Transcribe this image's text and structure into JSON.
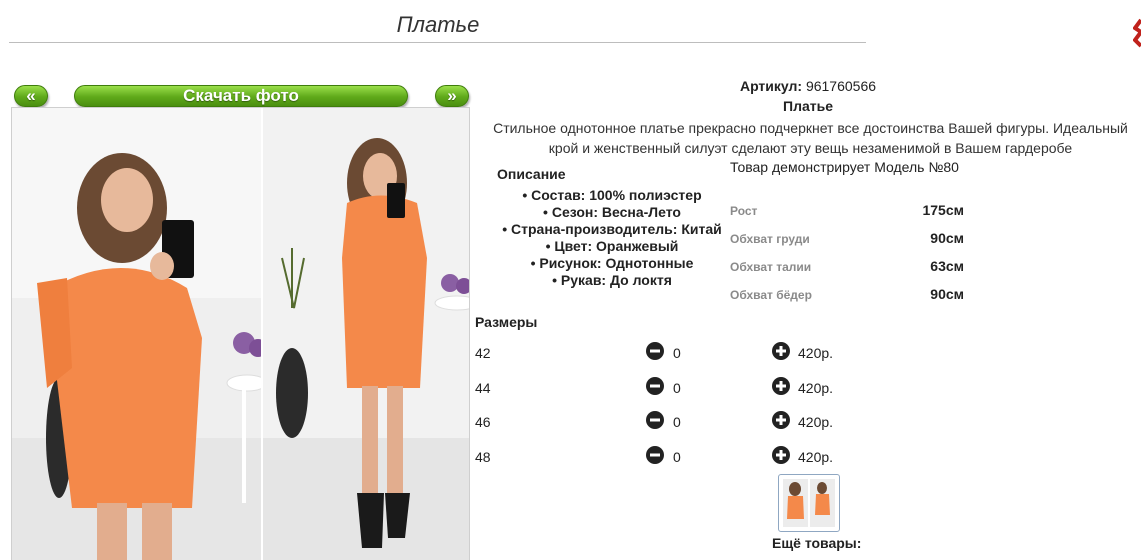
{
  "header": {
    "title": "Платье"
  },
  "nav": {
    "prev": "«",
    "download": "Скачать фото",
    "next": "»"
  },
  "product": {
    "article_label": "Артикул:",
    "article_value": "961760566",
    "name": "Платье",
    "description": "Стильное однотонное платье прекрасно подчеркнет все достоинства Вашей фигуры. Идеальный крой и женственный силуэт сделают эту вещь незаменимой в Вашем гардеробе"
  },
  "details": {
    "heading": "Описание",
    "features": [
      "Состав: 100% полиэстер",
      "Сезон: Весна-Лето",
      "Страна-производитель: Китай",
      "Цвет: Оранжевый",
      "Рисунок: Однотонные",
      "Рукав: До локтя"
    ]
  },
  "model": {
    "line": "Товар демонстрирует Модель №80",
    "measurements": [
      {
        "label": "Рост",
        "value": "175см"
      },
      {
        "label": "Обхват груди",
        "value": "90см"
      },
      {
        "label": "Обхват талии",
        "value": "63см"
      },
      {
        "label": "Обхват бёдер",
        "value": "90см"
      }
    ]
  },
  "sizes": {
    "heading": "Размеры",
    "rows": [
      {
        "size": "42",
        "qty": "0",
        "price": "420р."
      },
      {
        "size": "44",
        "qty": "0",
        "price": "420р."
      },
      {
        "size": "46",
        "qty": "0",
        "price": "420р."
      },
      {
        "size": "48",
        "qty": "0",
        "price": "420р."
      }
    ]
  },
  "more": {
    "heading": "Ещё товары:"
  },
  "colors": {
    "accent_green": "#5fa91a",
    "dress_orange": "#f4894a"
  },
  "icons": {
    "minus": "minus-circle-icon",
    "plus": "plus-circle-icon"
  }
}
